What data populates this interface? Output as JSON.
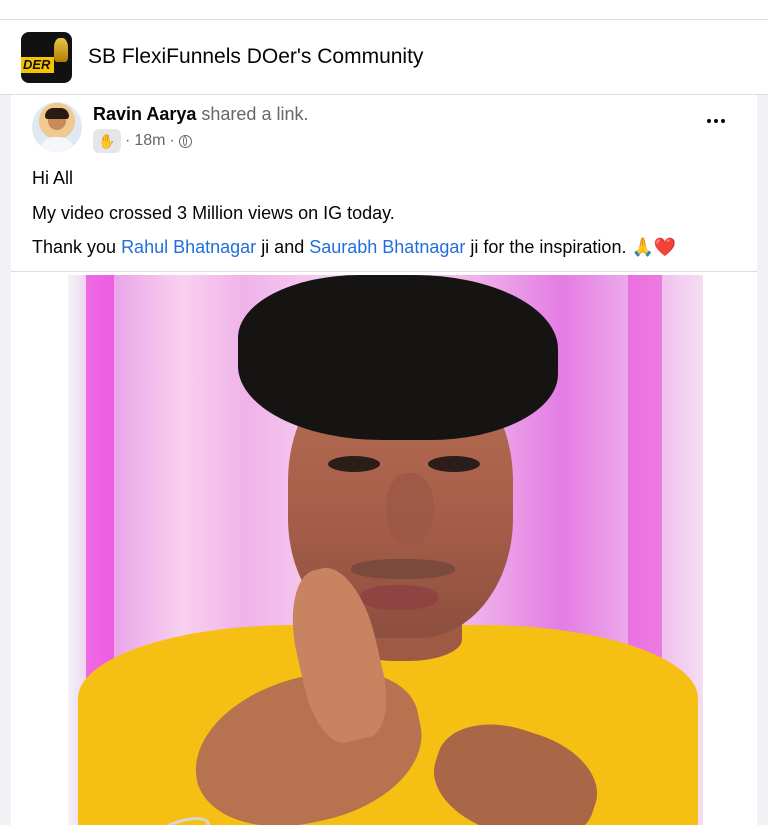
{
  "group": {
    "logo_text": "DER",
    "title": "SB FlexiFunnels DOer's Community"
  },
  "post": {
    "author": "Ravin Aarya",
    "action": "shared a link.",
    "time": "18m",
    "separator": "·",
    "badge_icon": "clap-icon",
    "privacy_icon": "globe-icon",
    "more_icon": "more-options-icon",
    "lines": {
      "greeting": "Hi All",
      "views": "My video crossed 3 Million views on IG today.",
      "thanks_prefix": "Thank you ",
      "mention_1": "Rahul Bhatnagar",
      "mid": " ji and ",
      "mention_2": "Saurabh Bhatnagar",
      "suffix": " ji for the inspiration. ",
      "emoji": "🙏❤️"
    }
  },
  "colors": {
    "background": "#f0f2f5",
    "card": "#ffffff",
    "text": "#050505",
    "secondary_text": "#65676b",
    "link": "#216fdb",
    "shirt": "#f5bf14",
    "pink_light": "#ea4bd9"
  }
}
